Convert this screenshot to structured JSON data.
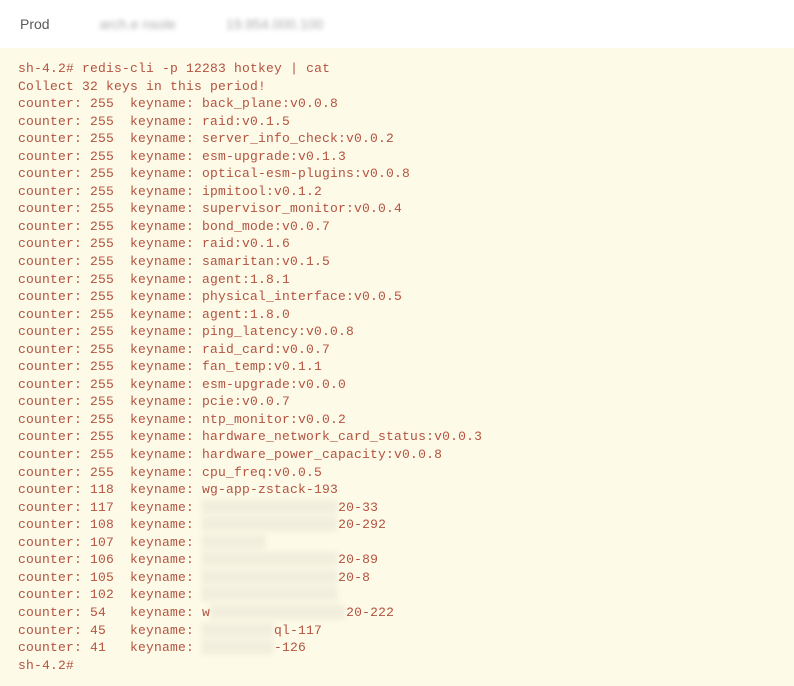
{
  "toolbar": {
    "env": "Prod",
    "breadcrumb": "arch.e       nsole",
    "host": "19.954.000.100"
  },
  "terminal": {
    "prompt": "sh-4.2#",
    "command": "redis-cli -p 12283 hotkey | cat",
    "collect_line": "Collect 32 keys in this period!",
    "hotkeys": [
      {
        "counter": 255,
        "keyname": "back_plane:v0.0.8",
        "redacted": false
      },
      {
        "counter": 255,
        "keyname": "raid:v0.1.5",
        "redacted": false
      },
      {
        "counter": 255,
        "keyname": "server_info_check:v0.0.2",
        "redacted": false
      },
      {
        "counter": 255,
        "keyname": "esm-upgrade:v0.1.3",
        "redacted": false
      },
      {
        "counter": 255,
        "keyname": "optical-esm-plugins:v0.0.8",
        "redacted": false
      },
      {
        "counter": 255,
        "keyname": "ipmitool:v0.1.2",
        "redacted": false
      },
      {
        "counter": 255,
        "keyname": "supervisor_monitor:v0.0.4",
        "redacted": false
      },
      {
        "counter": 255,
        "keyname": "bond_mode:v0.0.7",
        "redacted": false
      },
      {
        "counter": 255,
        "keyname": "raid:v0.1.6",
        "redacted": false
      },
      {
        "counter": 255,
        "keyname": "samaritan:v0.1.5",
        "redacted": false
      },
      {
        "counter": 255,
        "keyname": "agent:1.8.1",
        "redacted": false
      },
      {
        "counter": 255,
        "keyname": "physical_interface:v0.0.5",
        "redacted": false
      },
      {
        "counter": 255,
        "keyname": "agent:1.8.0",
        "redacted": false
      },
      {
        "counter": 255,
        "keyname": "ping_latency:v0.0.8",
        "redacted": false
      },
      {
        "counter": 255,
        "keyname": "raid_card:v0.0.7",
        "redacted": false
      },
      {
        "counter": 255,
        "keyname": "fan_temp:v0.1.1",
        "redacted": false
      },
      {
        "counter": 255,
        "keyname": "esm-upgrade:v0.0.0",
        "redacted": false
      },
      {
        "counter": 255,
        "keyname": "pcie:v0.0.7",
        "redacted": false
      },
      {
        "counter": 255,
        "keyname": "ntp_monitor:v0.0.2",
        "redacted": false
      },
      {
        "counter": 255,
        "keyname": "hardware_network_card_status:v0.0.3",
        "redacted": false
      },
      {
        "counter": 255,
        "keyname": "hardware_power_capacity:v0.0.8",
        "redacted": false
      },
      {
        "counter": 255,
        "keyname": "cpu_freq:v0.0.5",
        "redacted": false
      },
      {
        "counter": 118,
        "keyname": "wg-app-zstack-193",
        "redacted": false
      },
      {
        "counter": 117,
        "keyname": "██████████████████20-33",
        "redacted": true,
        "prefix": "",
        "suffix": "20-33"
      },
      {
        "counter": 108,
        "keyname": "██████████████████20-292",
        "redacted": true,
        "prefix": "",
        "suffix": "20-292"
      },
      {
        "counter": 107,
        "keyname": "████████",
        "redacted": true,
        "prefix": "",
        "suffix": ""
      },
      {
        "counter": 106,
        "keyname": "██████████████████20-89",
        "redacted": true,
        "prefix": "",
        "suffix": "20-89"
      },
      {
        "counter": 105,
        "keyname": "██████████████████20-8",
        "redacted": true,
        "prefix": "",
        "suffix": "20-8"
      },
      {
        "counter": 102,
        "keyname": "██████████████████",
        "redacted": true,
        "prefix": "",
        "suffix": ""
      },
      {
        "counter": 54,
        "keyname": "w██████████████████20-222",
        "redacted": true,
        "prefix": "w",
        "suffix": "20-222"
      },
      {
        "counter": 45,
        "keyname": "██████████ql-117",
        "redacted": true,
        "prefix": "",
        "suffix": "ql-117"
      },
      {
        "counter": 41,
        "keyname": "██████████-126",
        "redacted": true,
        "prefix": "",
        "suffix": "-126"
      }
    ],
    "trailing_prompt": "sh-4.2#"
  }
}
